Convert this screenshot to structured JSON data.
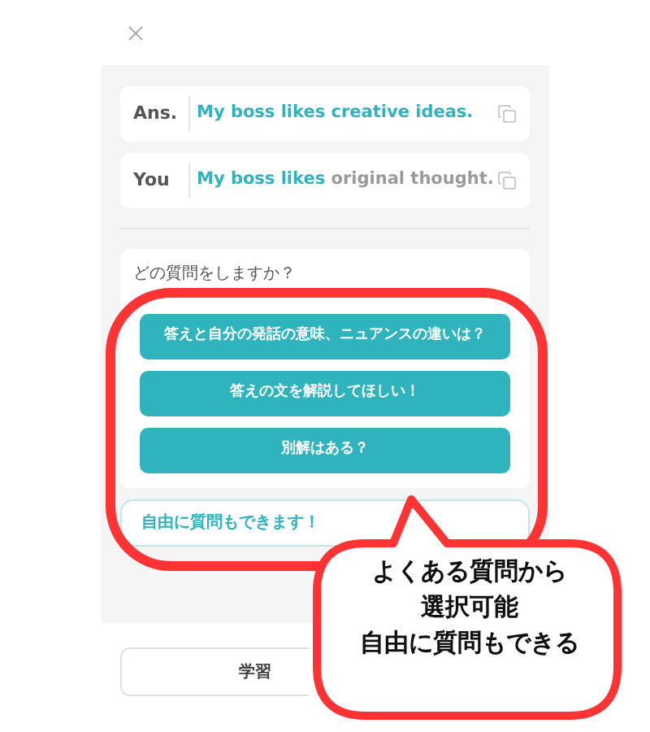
{
  "answer_rows": [
    {
      "label": "Ans.",
      "segments": [
        {
          "text": "My boss likes creative ideas.",
          "matched": true
        }
      ]
    },
    {
      "label": "You",
      "segments": [
        {
          "text": "My boss likes",
          "matched": true
        },
        {
          "text": "original thought.",
          "matched": false
        }
      ]
    }
  ],
  "question_prompt": "どの質問をしますか？",
  "suggested_questions": [
    "答えと自分の発話の意味、ニュアンスの違いは？",
    "答えの文を解説してほしい！",
    "別解はある？"
  ],
  "free_question": "自由に質問もできます！",
  "bottom_button": "学習",
  "callout_lines": [
    "よくある質問から",
    "選択可能",
    "自由に質問もできる"
  ]
}
